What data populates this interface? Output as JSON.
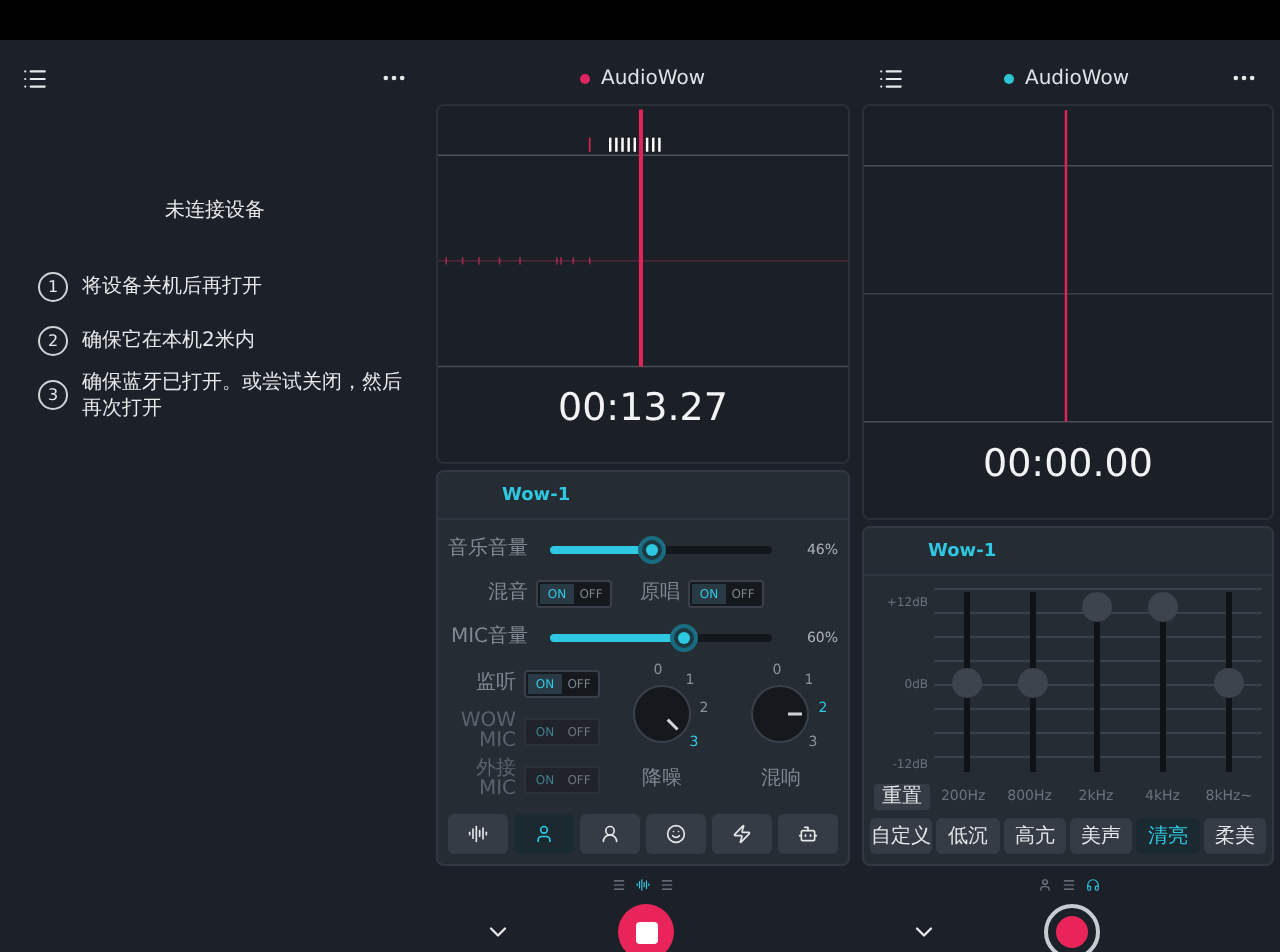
{
  "guide": {
    "title": "未连接设备",
    "steps": [
      {
        "number": "1",
        "text": "将设备关机后再打开"
      },
      {
        "number": "2",
        "text": "确保它在本机2米内"
      },
      {
        "number": "3",
        "text": "确保蓝牙已打开。或尝试关闭，然后再次打开"
      }
    ]
  },
  "mixer_screen": {
    "title": "AudioWow",
    "color": "#e0245e",
    "timer": "00:13.27",
    "recording": true,
    "panel_title": "Wow-1",
    "music_volume": {
      "label": "音乐音量",
      "level": 0.46,
      "reading": "46%"
    },
    "pair_toggles": [
      {
        "label": "混音",
        "on": true,
        "on_text": "ON",
        "off_text": "OFF"
      },
      {
        "label": "原唱",
        "on": true,
        "on_text": "ON",
        "off_text": "OFF"
      }
    ],
    "mic_volume": {
      "label": "MIC音量",
      "level": 0.6,
      "reading": "60%"
    },
    "side_toggles": [
      {
        "label": "监听",
        "on": true,
        "disabled": false,
        "on_text": "ON",
        "off_text": "OFF"
      },
      {
        "label": "WOW MIC",
        "on": true,
        "disabled": true,
        "on_text": "ON",
        "off_text": "OFF"
      },
      {
        "label": "外接 MIC",
        "on": true,
        "disabled": true,
        "on_text": "ON",
        "off_text": "OFF"
      }
    ],
    "knobs": [
      {
        "label": "降噪",
        "ticks": [
          {
            "text": "0",
            "selected": false
          },
          {
            "text": "1",
            "selected": false
          },
          {
            "text": "2",
            "selected": false
          },
          {
            "text": "3",
            "selected": true
          }
        ]
      },
      {
        "label": "混响",
        "ticks": [
          {
            "text": "0",
            "selected": false
          },
          {
            "text": "1",
            "selected": false
          },
          {
            "text": "2",
            "selected": true
          },
          {
            "text": "3",
            "selected": false
          }
        ]
      }
    ],
    "modes": [
      {
        "selected": false
      },
      {
        "selected": true
      },
      {
        "selected": false
      },
      {
        "selected": false
      },
      {
        "selected": false
      },
      {
        "selected": false
      }
    ],
    "pages": [
      {
        "selected": false
      },
      {
        "selected": true
      },
      {
        "selected": false
      }
    ]
  },
  "eq_screen": {
    "title": "AudioWow",
    "color": "#2ec4d6",
    "timer": "00:00.00",
    "recording": false,
    "panel_title": "Wow-1",
    "scale": [
      "+12dB",
      "0dB",
      "-12dB"
    ],
    "reset": "重置",
    "bands": [
      {
        "label": "200Hz",
        "level": 0.5
      },
      {
        "label": "800Hz",
        "level": 0.5
      },
      {
        "label": "2kHz",
        "level": 1
      },
      {
        "label": "4kHz",
        "level": 1
      },
      {
        "label": "8kHz~",
        "level": 0.5
      }
    ],
    "presets": [
      {
        "label": "自定义",
        "selected": false
      },
      {
        "label": "低沉",
        "selected": false
      },
      {
        "label": "高亢",
        "selected": false
      },
      {
        "label": "美声",
        "selected": false
      },
      {
        "label": "清亮",
        "selected": true
      },
      {
        "label": "柔美",
        "selected": false
      }
    ],
    "pages": [
      {
        "selected": false
      },
      {
        "selected": false
      },
      {
        "selected": true
      }
    ]
  }
}
